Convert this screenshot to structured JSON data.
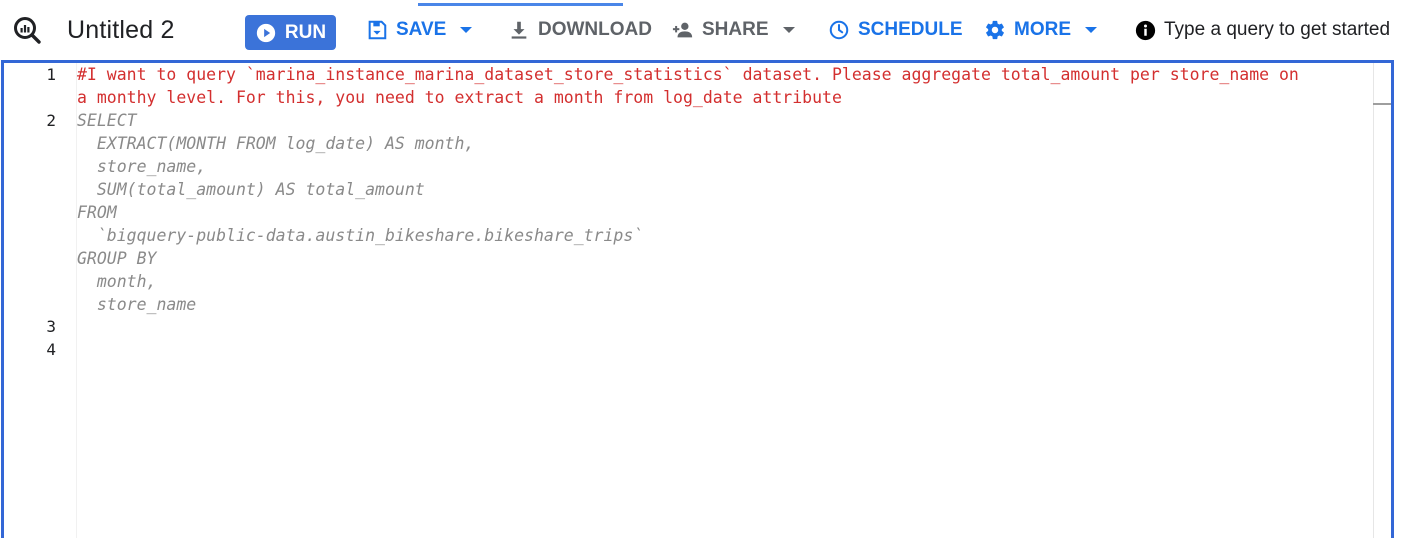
{
  "header": {
    "title": "Untitled 2",
    "run_label": "RUN",
    "save_label": "SAVE",
    "download_label": "DOWNLOAD",
    "share_label": "SHARE",
    "schedule_label": "SCHEDULE",
    "more_label": "MORE",
    "hint_text": "Type a query to get started"
  },
  "icons": {
    "logo": "query-search-icon",
    "run": "play-circle-icon",
    "save": "save-icon",
    "download": "download-icon",
    "share": "person-add-icon",
    "schedule": "clock-icon",
    "more": "gear-icon",
    "hint": "info-icon"
  },
  "colors": {
    "accent": "#1a73e8",
    "run_button": "#3b73d9",
    "editor_border": "#3367d6",
    "comment": "#d32f2f",
    "suggestion": "#8a8a8a"
  },
  "editor": {
    "line_numbers": [
      "1",
      "2",
      "3",
      "4"
    ],
    "comment_lines": [
      "#I want to query `marina_instance_marina_dataset_store_statistics` dataset. Please aggregate total_amount per store_name on",
      "a monthy level. For this, you need to extract a month from log_date attribute"
    ],
    "suggestion_lines": [
      "SELECT",
      "  EXTRACT(MONTH FROM log_date) AS month,",
      "  store_name,",
      "  SUM(total_amount) AS total_amount",
      "FROM",
      "  `bigquery-public-data.austin_bikeshare.bikeshare_trips`",
      "GROUP BY",
      "  month,",
      "  store_name"
    ]
  }
}
